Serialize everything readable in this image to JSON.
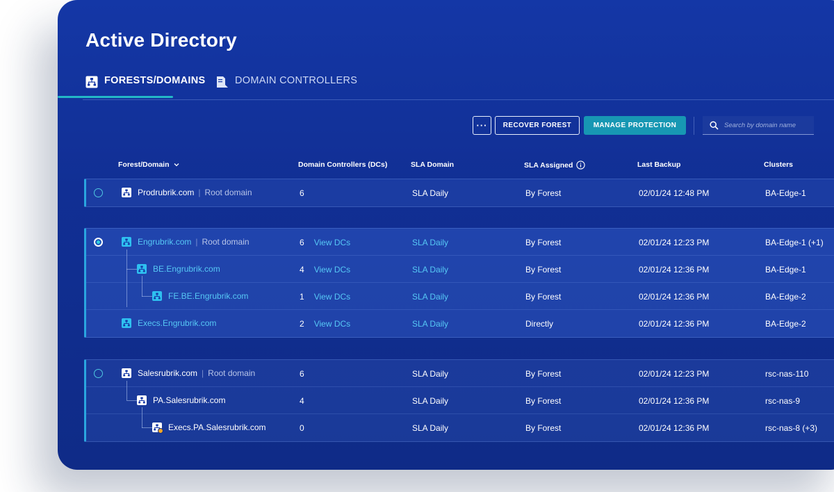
{
  "page": {
    "title": "Active Directory"
  },
  "tabs": [
    {
      "label": "FORESTS/DOMAINS",
      "active": true
    },
    {
      "label": "DOMAIN CONTROLLERS",
      "active": false
    }
  ],
  "toolbar": {
    "more_label": "···",
    "recover_label": "RECOVER FOREST",
    "manage_label": "MANAGE PROTECTION",
    "search_placeholder": "Search by domain name"
  },
  "columns": {
    "forest": "Forest/Domain",
    "dcs": "Domain Controllers (DCs)",
    "sla_domain": "SLA Domain",
    "sla_assigned": "SLA Assigned",
    "last_backup": "Last Backup",
    "clusters": "Clusters"
  },
  "common": {
    "view_dcs": "View DCs",
    "root_domain": "Root domain"
  },
  "forests": [
    {
      "selected": false,
      "rows": [
        {
          "name": "Prodrubrik.com",
          "root": true,
          "dcs": "6",
          "view_dcs": false,
          "sla_domain": "SLA Daily",
          "sla_assigned": "By Forest",
          "last_backup": "02/01/24 12:48 PM",
          "clusters": "BA-Edge-1"
        }
      ]
    },
    {
      "selected": true,
      "rows": [
        {
          "name": "Engrubrik.com",
          "root": true,
          "dcs": "6",
          "view_dcs": true,
          "sla_domain": "SLA Daily",
          "sla_assigned": "By Forest",
          "last_backup": "02/01/24 12:23 PM",
          "clusters": "BA-Edge-1 (+1)"
        },
        {
          "name": "BE.Engrubrik.com",
          "root": false,
          "dcs": "4",
          "view_dcs": true,
          "sla_domain": "SLA Daily",
          "sla_assigned": "By Forest",
          "last_backup": "02/01/24 12:36 PM",
          "clusters": "BA-Edge-1"
        },
        {
          "name": "FE.BE.Engrubrik.com",
          "root": false,
          "dcs": "1",
          "view_dcs": true,
          "sla_domain": "SLA Daily",
          "sla_assigned": "By Forest",
          "last_backup": "02/01/24 12:36 PM",
          "clusters": "BA-Edge-2"
        },
        {
          "name": "Execs.Engrubrik.com",
          "root": false,
          "dcs": "2",
          "view_dcs": true,
          "sla_domain": "SLA Daily",
          "sla_assigned": "Directly",
          "last_backup": "02/01/24 12:36 PM",
          "clusters": "BA-Edge-2"
        }
      ]
    },
    {
      "selected": false,
      "rows": [
        {
          "name": "Salesrubrik.com",
          "root": true,
          "dcs": "6",
          "view_dcs": false,
          "sla_domain": "SLA Daily",
          "sla_assigned": "By Forest",
          "last_backup": "02/01/24 12:23 PM",
          "clusters": "rsc-nas-110"
        },
        {
          "name": "PA.Salesrubrik.com",
          "root": false,
          "dcs": "4",
          "view_dcs": false,
          "sla_domain": "SLA Daily",
          "sla_assigned": "By Forest",
          "last_backup": "02/01/24 12:36 PM",
          "clusters": "rsc-nas-9"
        },
        {
          "name": "Execs.PA.Salesrubrik.com",
          "root": false,
          "warning": true,
          "dcs": "0",
          "view_dcs": false,
          "sla_domain": "SLA Daily",
          "sla_assigned": "By Forest",
          "last_backup": "02/01/24 12:36 PM",
          "clusters": "rsc-nas-8 (+3)"
        }
      ]
    }
  ],
  "colors": {
    "accent": "#1797b3",
    "link": "#56c8f5",
    "underline": "#23b8c6",
    "panel": "#1437a6"
  }
}
